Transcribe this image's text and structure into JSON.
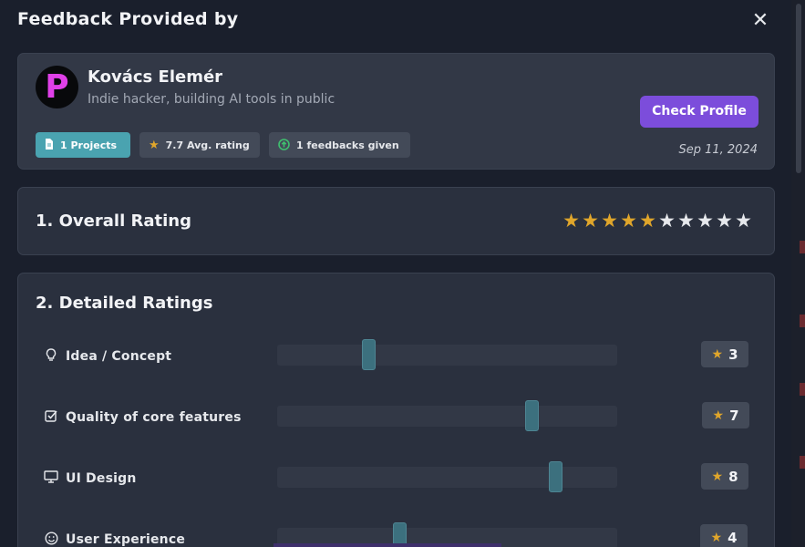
{
  "modal": {
    "title": "Feedback Provided by",
    "close_icon": "close-icon"
  },
  "profile": {
    "avatar_letter": "P",
    "name": "Kovács Elemér",
    "tagline": "Indie hacker, building AI tools in public",
    "check_profile_label": "Check Profile",
    "date": "Sep 11, 2024",
    "badges": [
      {
        "icon": "document-icon",
        "label": "1 Projects",
        "color": "#4aa3b0"
      },
      {
        "icon": "star-icon",
        "label": "7.7 Avg. rating",
        "color": "#434a58"
      },
      {
        "icon": "arrow-up-circle-icon",
        "label": "1 feedbacks given",
        "color": "#434a58"
      }
    ]
  },
  "overall": {
    "title": "1. Overall Rating",
    "rating": 5,
    "max": 10
  },
  "detailed": {
    "title": "2. Detailed Ratings",
    "items": [
      {
        "icon": "lightbulb-icon",
        "label": "Idea / Concept",
        "score": "3",
        "value": 3
      },
      {
        "icon": "checkbox-icon",
        "label": "Quality of core features",
        "score": "7",
        "value": 7
      },
      {
        "icon": "monitor-icon",
        "label": "UI Design",
        "score": "8",
        "value": 8
      },
      {
        "icon": "smiley-icon",
        "label": "User Experience",
        "score": "4",
        "value": 4
      }
    ]
  },
  "colors": {
    "accent": "#7c4ddb",
    "star": "#e0a62b",
    "slider_handle": "#3c707e"
  }
}
